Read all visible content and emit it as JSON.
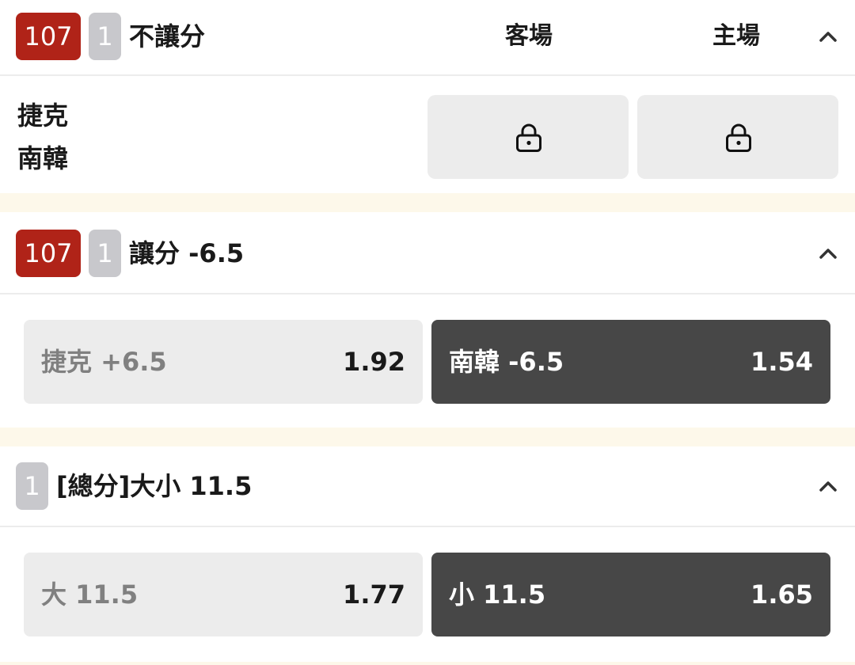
{
  "markets": [
    {
      "event_no": "107",
      "count": "1",
      "title": "不讓分",
      "col_away": "客場",
      "col_home": "主場",
      "teams": [
        "捷克",
        "南韓"
      ],
      "away_locked": true,
      "home_locked": true
    },
    {
      "event_no": "107",
      "count": "1",
      "title": "讓分 -6.5",
      "options": [
        {
          "label": "捷克 +6.5",
          "odds": "1.92",
          "selected": false
        },
        {
          "label": "南韓 -6.5",
          "odds": "1.54",
          "selected": true
        }
      ]
    },
    {
      "count": "1",
      "title": "[總分]大小 11.5",
      "options": [
        {
          "label": "大 11.5",
          "odds": "1.77",
          "selected": false
        },
        {
          "label": "小 11.5",
          "odds": "1.65",
          "selected": true
        }
      ]
    }
  ],
  "icons": {
    "collapse": "chevron-up-icon",
    "locked": "lock-icon"
  },
  "colors": {
    "badge_red": "#b02318",
    "badge_gray": "#c8c8cc",
    "selected_bg": "#474747",
    "unselected_bg": "#ececec",
    "page_bg": "#fdf8ea"
  }
}
